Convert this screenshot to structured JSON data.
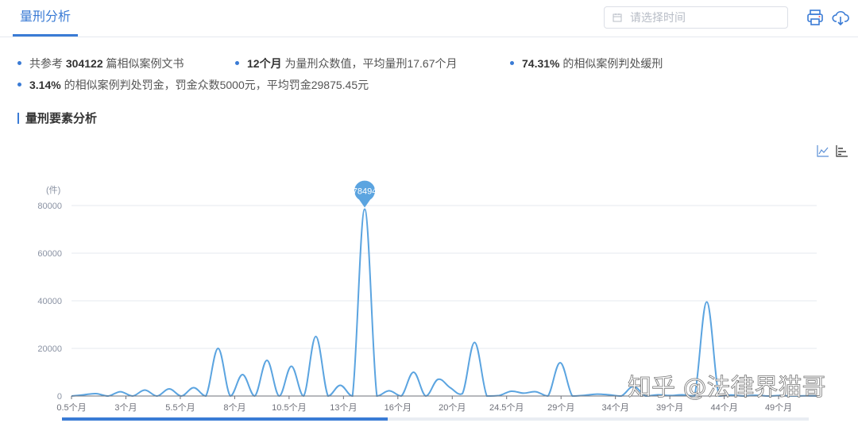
{
  "header": {
    "tab_label": "量刑分析",
    "date_placeholder": "请选择时间",
    "print_icon": "printer-icon",
    "download_icon": "cloud-download-icon",
    "accent_color": "#3a7bd5"
  },
  "summary": {
    "item1": {
      "pre": "共参考 ",
      "value": "304122",
      "post": " 篇相似案例文书"
    },
    "item2": {
      "value": "12个月",
      "post": " 为量刑众数值，平均量刑17.67个月"
    },
    "item3": {
      "value": "74.31%",
      "post": " 的相似案例判处缓刑"
    },
    "item4": {
      "value": "3.14%",
      "post": " 的相似案例判处罚金，罚金众数5000元，平均罚金29875.45元"
    }
  },
  "section_title": "量刑要素分析",
  "toolbox": {
    "line_icon": "line-chart-icon",
    "bar_icon": "bar-chart-icon"
  },
  "watermark": "知乎 @法律界猫哥",
  "chart_data": {
    "type": "line",
    "line_color": "#5ba4e0",
    "ylabel": "(件)",
    "ylim": [
      0,
      80000
    ],
    "yticks": [
      "0",
      "20000",
      "40000",
      "60000",
      "80000"
    ],
    "xtick_labels": [
      "0.5个月",
      "3个月",
      "5.5个月",
      "8个月",
      "10.5个月",
      "13个月",
      "16个月",
      "20个月",
      "24.5个月",
      "29个月",
      "34个月",
      "39个月",
      "44个月",
      "49个月"
    ],
    "grid": true,
    "marker": {
      "label": "78494",
      "value": 78494
    },
    "series": [
      {
        "values": [
          0,
          500,
          1000,
          0,
          1800,
          0,
          2500,
          0,
          3000,
          0,
          3500,
          0,
          20000,
          0,
          9000,
          0,
          15000,
          0,
          12500,
          0,
          25000,
          0,
          4500,
          0,
          78494,
          0,
          2200,
          0,
          10000,
          0,
          7000,
          3500,
          1000,
          22500,
          0,
          200,
          2000,
          1200,
          1800,
          0,
          14000,
          0,
          300,
          800,
          500,
          0,
          4000,
          0,
          500,
          200,
          500,
          0,
          39500,
          0,
          400,
          0,
          300,
          0,
          200,
          0,
          100,
          0
        ]
      }
    ],
    "x_start": 0.5,
    "x_end": 54
  }
}
